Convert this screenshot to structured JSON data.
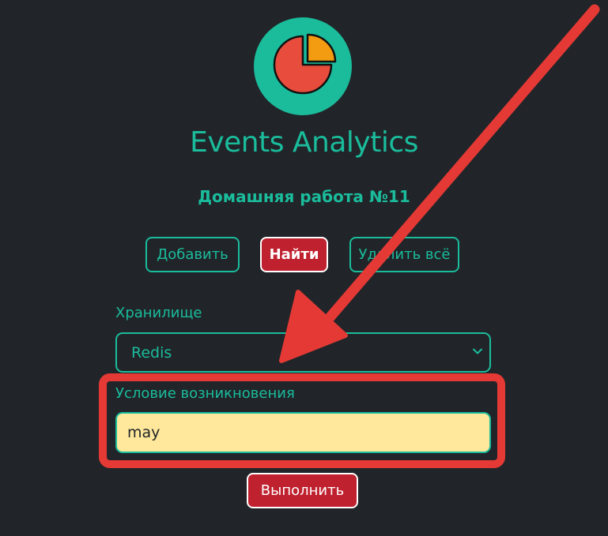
{
  "app": {
    "title": "Events Analytics",
    "subtitle": "Домашняя работа №11"
  },
  "logo": {
    "icon": "pie-chart-icon",
    "colors": {
      "background": "#1abc9c",
      "slice_main": "#e74c3c",
      "slice_small": "#f39c12"
    }
  },
  "toolbar": {
    "add_label": "Добавить",
    "find_label": "Найти",
    "delete_all_label": "Удалить всё"
  },
  "form": {
    "storage_label": "Хранилище",
    "storage_selected": "Redis",
    "condition_label": "Условие возникновения",
    "condition_value": "may",
    "submit_label": "Выполнить"
  },
  "annotation": {
    "type": "arrow-and-highlight",
    "color": "#e53935"
  },
  "colors": {
    "background": "#212529",
    "accent": "#1abc9c",
    "primary_button": "#c0212f",
    "input_fill": "#ffe89b"
  }
}
